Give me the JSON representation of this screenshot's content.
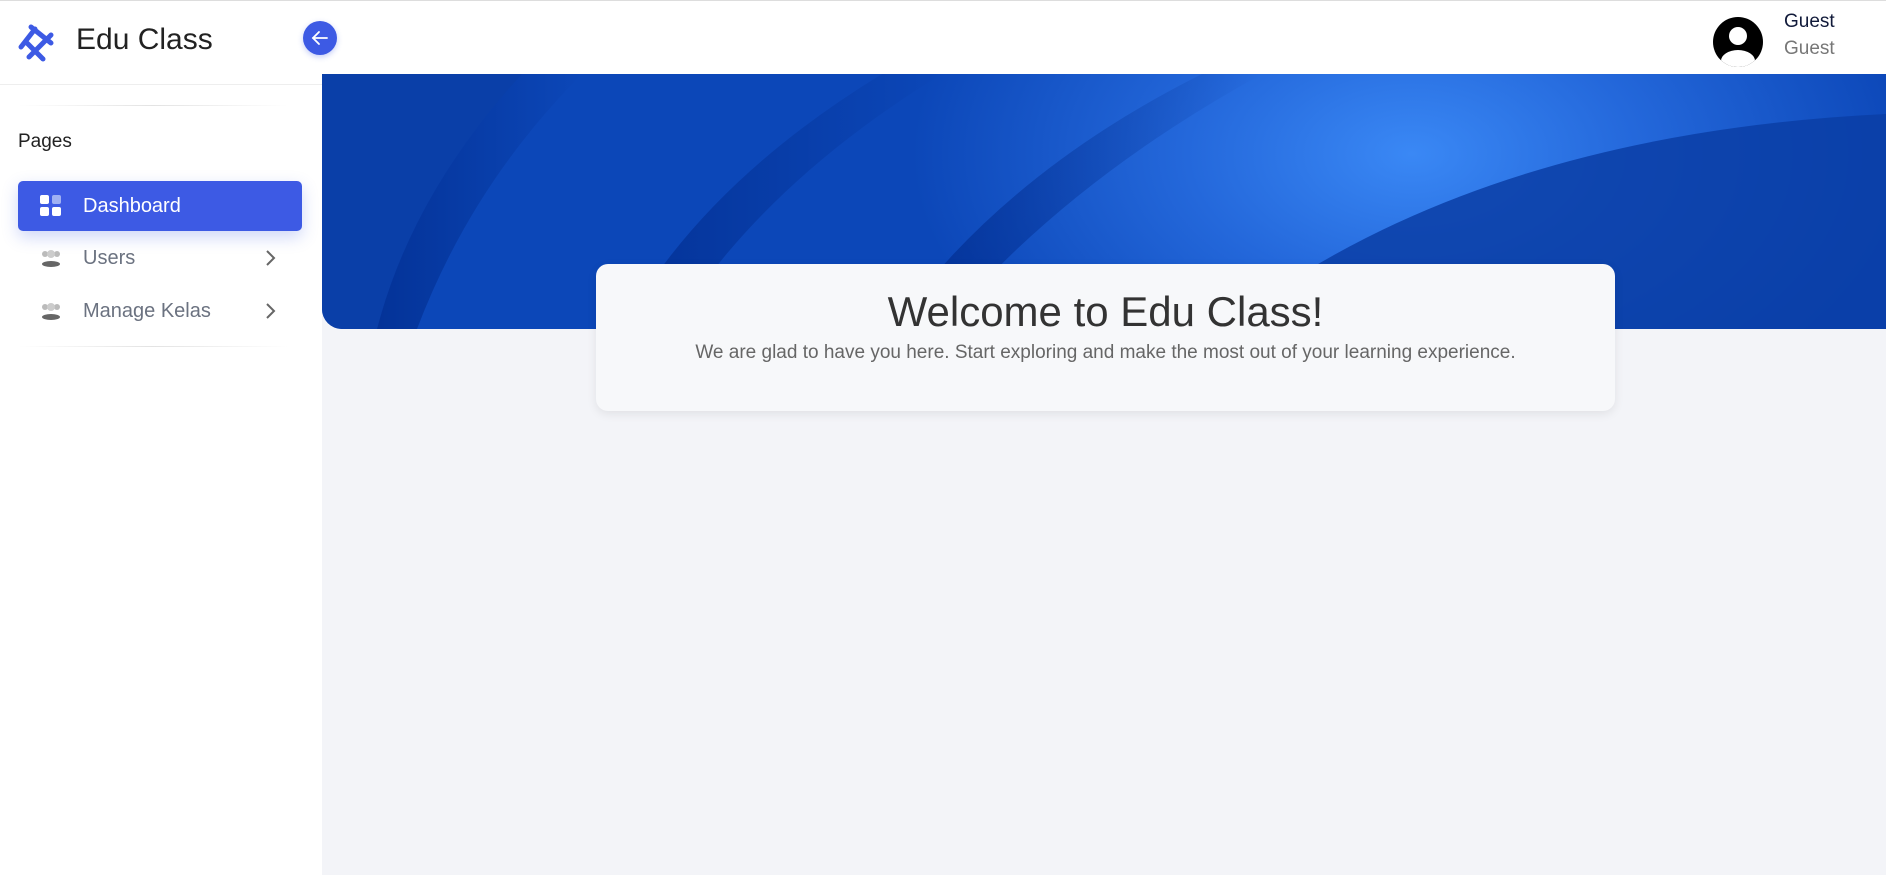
{
  "brand": {
    "title": "Edu Class",
    "accent": "#3d5ae4"
  },
  "sidebar": {
    "section": "Pages",
    "items": [
      {
        "label": "Dashboard",
        "icon": "grid-icon",
        "active": true
      },
      {
        "label": "Users",
        "icon": "users-icon",
        "active": false
      },
      {
        "label": "Manage Kelas",
        "icon": "users-icon",
        "active": false
      }
    ]
  },
  "user": {
    "name": "Guest",
    "role": "Guest"
  },
  "welcome": {
    "title": "Welcome to Edu Class!",
    "subtitle": "We are glad to have you here. Start exploring and make the most out of your learning experience."
  }
}
